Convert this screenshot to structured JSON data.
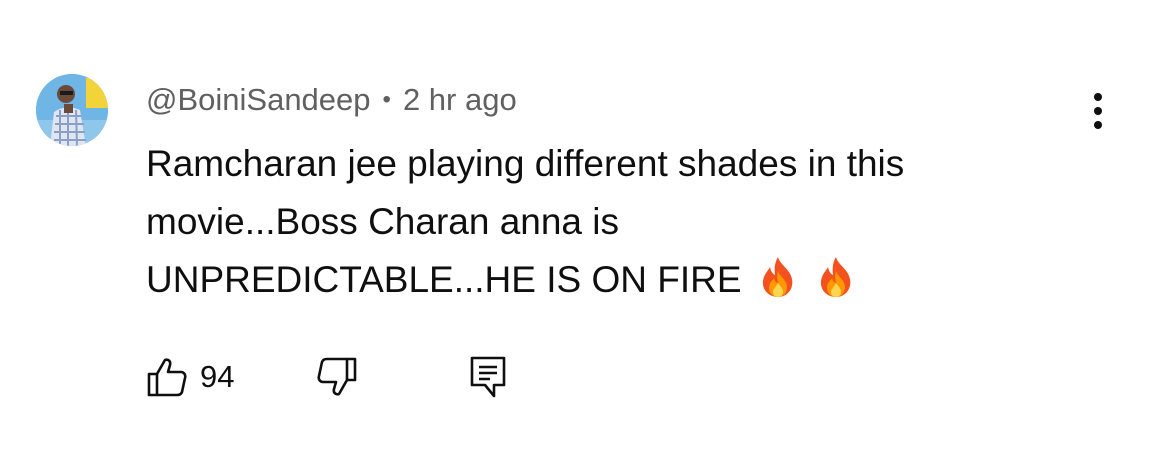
{
  "comment": {
    "author": "@BoiniSandeep",
    "separator": "•",
    "time": "2 hr ago",
    "text_lines": [
      "Ramcharan jee playing different shades in this",
      "movie...Boss Charan anna is",
      "UNPREDICTABLE...HE IS ON FIRE"
    ],
    "emoji": "fire-emoji",
    "emoji_count": 2,
    "like_count": "94"
  },
  "icons": {
    "like": "thumbs-up-icon",
    "dislike": "thumbs-down-icon",
    "reply": "reply-comment-icon",
    "more": "more-vertical-icon"
  }
}
